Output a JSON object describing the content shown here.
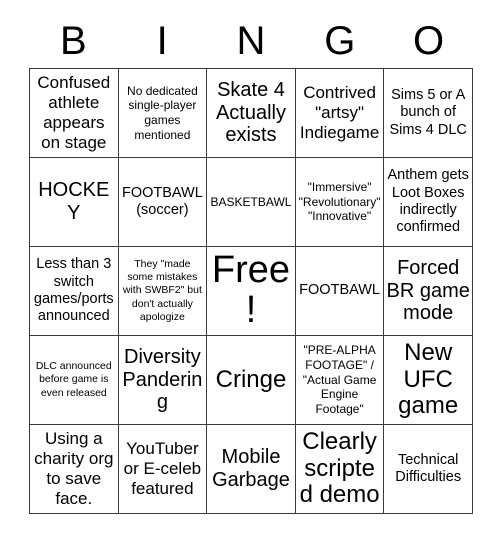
{
  "header": {
    "letters": [
      "B",
      "I",
      "N",
      "G",
      "O"
    ]
  },
  "grid": {
    "rows": 5,
    "columns": 5,
    "cells": [
      {
        "text": "Confused athlete appears on stage",
        "size": "l"
      },
      {
        "text": "No dedicated single-player games mentioned",
        "size": "s"
      },
      {
        "text": "Skate 4 Actually exists",
        "size": "xl"
      },
      {
        "text": "Contrived \"artsy\" Indiegame",
        "size": "l"
      },
      {
        "text": "Sims 5 or A bunch of Sims 4 DLC",
        "size": "m"
      },
      {
        "text": "HOCKEY",
        "size": "xl"
      },
      {
        "text": "FOOTBAWL (soccer)",
        "size": "m"
      },
      {
        "text": "BASKETBAWL",
        "size": "s"
      },
      {
        "text": "\"Immersive\" \"Revolutionary\" \"Innovative\"",
        "size": "s"
      },
      {
        "text": "Anthem gets Loot Boxes indirectly confirmed",
        "size": "m"
      },
      {
        "text": "Less than 3 switch games/ports announced",
        "size": "m"
      },
      {
        "text": "They \"made some mistakes with SWBF2\" but don't actually apologize",
        "size": "xs"
      },
      {
        "text": "Free!",
        "size": "free"
      },
      {
        "text": "FOOTBAWL",
        "size": "m"
      },
      {
        "text": "Forced BR game mode",
        "size": "xl"
      },
      {
        "text": "DLC announced before game is even released",
        "size": "xs"
      },
      {
        "text": "Diversity Pandering",
        "size": "xl"
      },
      {
        "text": "Cringe",
        "size": "xxl"
      },
      {
        "text": "\"PRE-ALPHA FOOTAGE\" / \"Actual Game Engine Footage\"",
        "size": "s"
      },
      {
        "text": "New UFC game",
        "size": "xxl"
      },
      {
        "text": "Using a charity org to save face.",
        "size": "l"
      },
      {
        "text": "YouTuber or E-celeb featured",
        "size": "l"
      },
      {
        "text": "Mobile Garbage",
        "size": "xl"
      },
      {
        "text": "Clearly scripted demo",
        "size": "xxl"
      },
      {
        "text": "Technical Difficulties",
        "size": "m"
      }
    ]
  },
  "colors": {
    "background": "#ffffff",
    "border": "#3a3a3a",
    "text": "#000000"
  }
}
